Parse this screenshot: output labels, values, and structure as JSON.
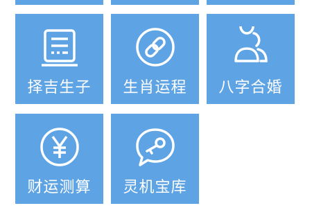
{
  "tiles": [
    {
      "label": "择吉生子",
      "icon": "calendar-box-icon"
    },
    {
      "label": "生肖运程",
      "icon": "chain-link-icon"
    },
    {
      "label": "八字合婚",
      "icon": "couple-icon"
    },
    {
      "label": "财运测算",
      "icon": "yen-coin-icon"
    },
    {
      "label": "灵机宝库",
      "icon": "key-chat-icon"
    }
  ],
  "colors": {
    "tile": "#5ea3e4",
    "text": "#ffffff",
    "background": "#ffffff"
  }
}
